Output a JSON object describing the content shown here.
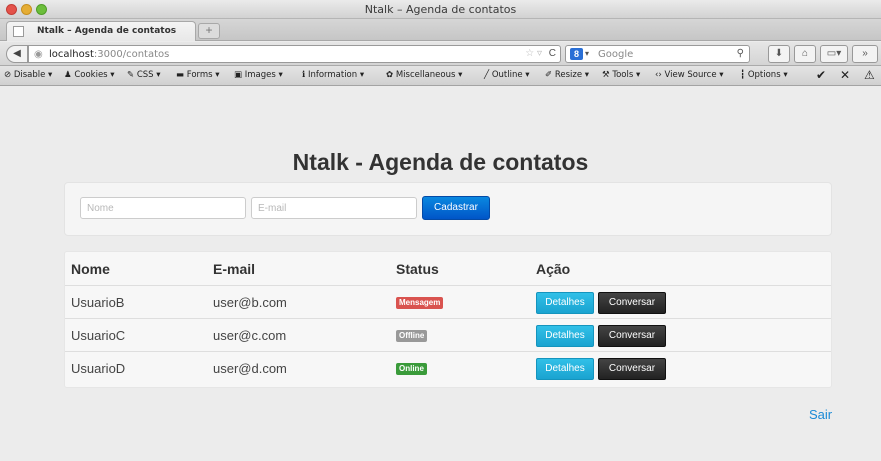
{
  "window": {
    "title": "Ntalk – Agenda de contatos"
  },
  "tab": {
    "label": "Ntalk – Agenda de contatos",
    "new_tab": "+"
  },
  "navbar": {
    "url_host": "localhost",
    "url_path": ":3000/contatos",
    "search_placeholder": "Google",
    "search_engine_letter": "8"
  },
  "devtoolbar": {
    "items": [
      "Disable",
      "Cookies",
      "CSS",
      "Forms",
      "Images",
      "Information",
      "Miscellaneous",
      "Outline",
      "Resize",
      "Tools",
      "View Source",
      "Options"
    ]
  },
  "page": {
    "title": "Ntalk - Agenda de contatos",
    "form": {
      "name_placeholder": "Nome",
      "email_placeholder": "E-mail",
      "submit_label": "Cadastrar"
    },
    "table": {
      "headers": [
        "Nome",
        "E-mail",
        "Status",
        "Ação"
      ],
      "rows": [
        {
          "name": "UsuarioB",
          "email": "user@b.com",
          "status": "Mensagem",
          "status_color": "#d9534f",
          "details": "Detalhes",
          "chat": "Conversar"
        },
        {
          "name": "UsuarioC",
          "email": "user@c.com",
          "status": "Offline",
          "status_color": "#999999",
          "details": "Detalhes",
          "chat": "Conversar"
        },
        {
          "name": "UsuarioD",
          "email": "user@d.com",
          "status": "Online",
          "status_color": "#3a9b3a",
          "details": "Detalhes",
          "chat": "Conversar"
        }
      ]
    },
    "logout_label": "Sair"
  }
}
